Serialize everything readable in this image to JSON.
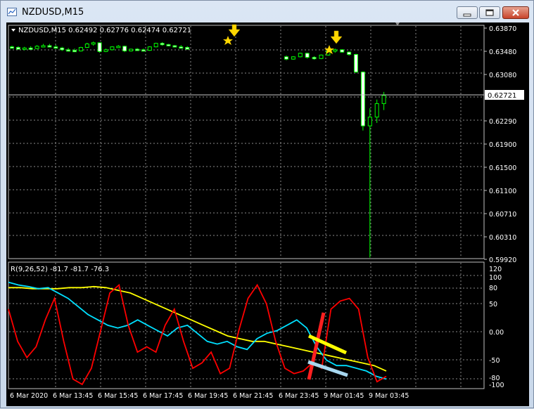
{
  "window": {
    "title": "NZDUSD,M15"
  },
  "chart": {
    "symbol_header": "NZDUSD,M15  0.62492 0.62776 0.62474 0.62721",
    "current_price_label": "0.62721",
    "price_axis": [
      "0.63870",
      "0.63480",
      "0.63080",
      "0.62290",
      "0.61900",
      "0.61500",
      "0.61100",
      "0.60710",
      "0.60310",
      "0.59920"
    ],
    "time_axis": [
      "6 Mar 2020",
      "6 Mar 13:45",
      "6 Mar 15:45",
      "6 Mar 17:45",
      "6 Mar 19:45",
      "6 Mar 21:45",
      "6 Mar 23:45",
      "9 Mar 01:45",
      "9 Mar 03:45"
    ]
  },
  "indicator": {
    "header": "R(9,26,52) -81.7 -81.7 -76.3",
    "axis": [
      "120",
      "100",
      "80",
      "50",
      "0.00",
      "-50",
      "-80",
      "-100"
    ]
  },
  "colors": {
    "bull": "#00ff00",
    "bear": "#000000",
    "wick": "#00ff00",
    "red": "#ff0000",
    "cyan": "#00e0ff",
    "yellow": "#ffff00",
    "lightblue": "#a8d8f0"
  },
  "chart_data": {
    "type": "candlestick",
    "price_candles_approx": [
      [
        0.6355,
        0.6357,
        0.6352,
        0.6354
      ],
      [
        0.6354,
        0.6356,
        0.635,
        0.6351
      ],
      [
        0.6351,
        0.6355,
        0.6349,
        0.6353
      ],
      [
        0.6353,
        0.6356,
        0.635,
        0.6352
      ],
      [
        0.6352,
        0.6358,
        0.6351,
        0.6356
      ],
      [
        0.6356,
        0.636,
        0.6354,
        0.6357
      ],
      [
        0.6357,
        0.636,
        0.6354,
        0.6355
      ],
      [
        0.6355,
        0.6358,
        0.6352,
        0.6353
      ],
      [
        0.6353,
        0.6355,
        0.6348,
        0.635
      ],
      [
        0.635,
        0.6353,
        0.6347,
        0.6349
      ],
      [
        0.6349,
        0.6352,
        0.6346,
        0.6348
      ],
      [
        0.6348,
        0.6355,
        0.6347,
        0.6354
      ],
      [
        0.6354,
        0.6362,
        0.6353,
        0.636
      ],
      [
        0.636,
        0.6364,
        0.6357,
        0.6362
      ],
      [
        0.6362,
        0.6362,
        0.6345,
        0.6347
      ],
      [
        0.6347,
        0.6352,
        0.6346,
        0.635
      ],
      [
        0.635,
        0.6356,
        0.6349,
        0.6355
      ],
      [
        0.6355,
        0.6358,
        0.6353,
        0.6356
      ],
      [
        0.6356,
        0.6357,
        0.6346,
        0.6348
      ],
      [
        0.6348,
        0.6352,
        0.6347,
        0.6351
      ],
      [
        0.6351,
        0.6353,
        0.6349,
        0.635
      ],
      [
        0.635,
        0.6352,
        0.6348,
        0.6349
      ],
      [
        0.6349,
        0.6356,
        0.6348,
        0.6355
      ],
      [
        0.6355,
        0.6362,
        0.6354,
        0.6361
      ],
      [
        0.6361,
        0.6363,
        0.6357,
        0.6359
      ],
      [
        0.6359,
        0.636,
        0.6356,
        0.6357
      ],
      [
        0.6357,
        0.6358,
        0.6354,
        0.6355
      ],
      [
        0.6355,
        0.6358,
        0.6353,
        0.6354
      ],
      [
        0.6354,
        0.6356,
        0.635,
        0.6351
      ],
      [
        0.6338,
        0.634,
        0.6332,
        0.6334
      ],
      [
        0.6334,
        0.6339,
        0.6333,
        0.6338
      ],
      [
        0.6338,
        0.6345,
        0.6337,
        0.6344
      ],
      [
        0.6344,
        0.6345,
        0.6335,
        0.6337
      ],
      [
        0.6337,
        0.6339,
        0.6333,
        0.6335
      ],
      [
        0.6335,
        0.6342,
        0.6334,
        0.6341
      ],
      [
        0.6341,
        0.635,
        0.634,
        0.6348
      ],
      [
        0.6348,
        0.6352,
        0.6345,
        0.635
      ],
      [
        0.635,
        0.6351,
        0.6345,
        0.6346
      ],
      [
        0.6346,
        0.6347,
        0.634,
        0.6342
      ],
      [
        0.6342,
        0.6343,
        0.631,
        0.6312
      ],
      [
        0.6312,
        0.6313,
        0.6212,
        0.622
      ],
      [
        0.622,
        0.625,
        0.5995,
        0.6235
      ],
      [
        0.6235,
        0.6265,
        0.6225,
        0.6258
      ],
      [
        0.6258,
        0.6278,
        0.6247,
        0.6272
      ]
    ],
    "indicator_series_approx": {
      "red": [
        40,
        -20,
        -50,
        -30,
        20,
        60,
        -20,
        -90,
        -100,
        -70,
        0,
        70,
        85,
        10,
        -40,
        -30,
        -40,
        10,
        40,
        -20,
        -70,
        -60,
        -40,
        -80,
        -70,
        0,
        60,
        85,
        50,
        -20,
        -70,
        -80,
        -75,
        -60,
        -70,
        40,
        55,
        60,
        40,
        -50,
        -95,
        -85
      ],
      "cyan": [
        90,
        85,
        82,
        78,
        80,
        70,
        60,
        45,
        30,
        20,
        10,
        5,
        10,
        20,
        10,
        0,
        -10,
        5,
        10,
        -5,
        -20,
        -25,
        -20,
        -30,
        -35,
        -15,
        -5,
        0,
        10,
        20,
        5,
        -30,
        -55,
        -65,
        -65,
        -70,
        -75,
        -85,
        -90
      ],
      "yellow": [
        80,
        80,
        78,
        78,
        78,
        80,
        80,
        82,
        80,
        75,
        70,
        60,
        50,
        40,
        30,
        20,
        10,
        0,
        -10,
        -15,
        -20,
        -20,
        -25,
        -30,
        -35,
        -40,
        -45,
        -50,
        -55,
        -60,
        -65,
        -75
      ]
    }
  }
}
